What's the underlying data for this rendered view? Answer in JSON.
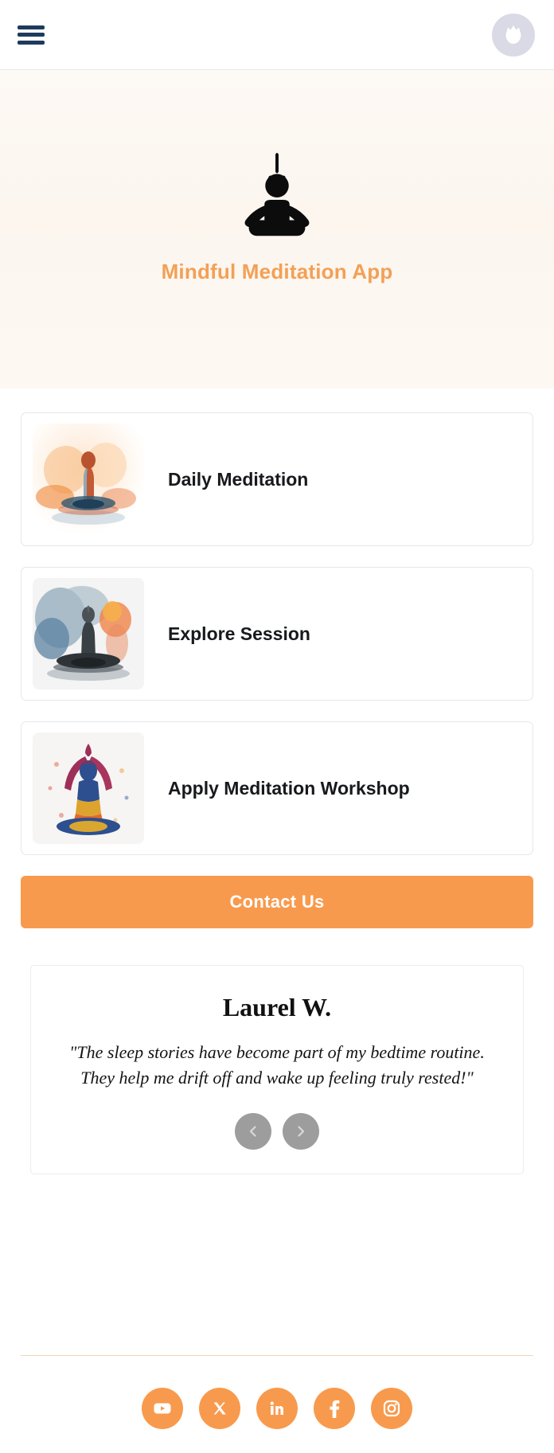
{
  "header": {
    "menu_icon": "hamburger-menu-icon",
    "avatar_icon": "user-avatar-icon"
  },
  "hero": {
    "logo_icon": "meditating-person-icon",
    "title": "Mindful Meditation App",
    "title_color": "#f3a055",
    "background_color": "#fcf7f1"
  },
  "cards": [
    {
      "label": "Daily Meditation",
      "thumb_icon": "watercolor-meditation-orange-image"
    },
    {
      "label": "Explore Session",
      "thumb_icon": "watercolor-meditation-blue-image"
    },
    {
      "label": "Apply Meditation Workshop",
      "thumb_icon": "watercolor-yoga-colorful-image"
    }
  ],
  "cta": {
    "label": "Contact Us",
    "background_color": "#f89a4d",
    "text_color": "#ffffff"
  },
  "testimonial": {
    "name": "Laurel W.",
    "quote": "\"The sleep stories have become part of my bedtime routine. They help me drift off and wake up feeling truly rested!\"",
    "prev_icon": "chevron-left-icon",
    "next_icon": "chevron-right-icon"
  },
  "footer": {
    "divider_color": "#f0d6b8",
    "social_color": "#f89a4d",
    "socials": [
      {
        "name": "youtube",
        "label": "YouTube"
      },
      {
        "name": "x-twitter",
        "label": "X"
      },
      {
        "name": "linkedin",
        "label": "LinkedIn"
      },
      {
        "name": "facebook",
        "label": "Facebook"
      },
      {
        "name": "instagram",
        "label": "Instagram"
      }
    ]
  }
}
